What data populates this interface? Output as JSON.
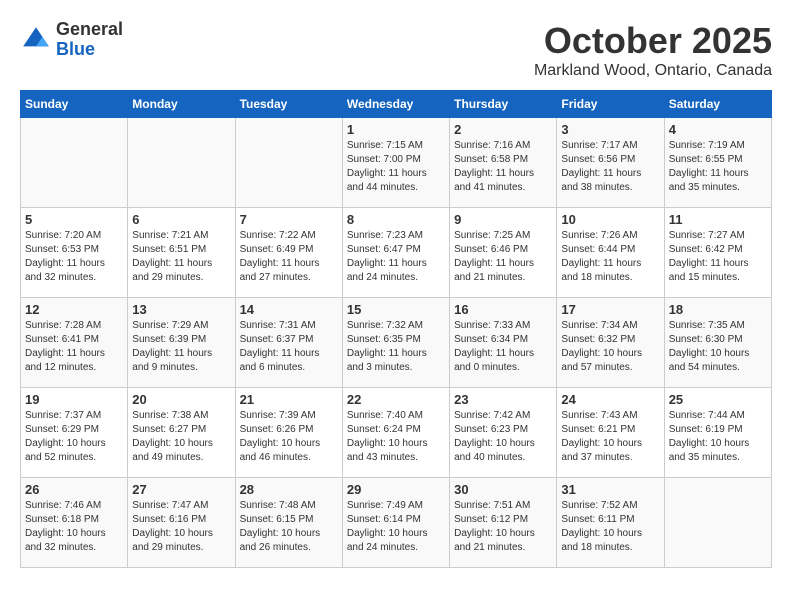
{
  "header": {
    "logo_line1": "General",
    "logo_line2": "Blue",
    "month": "October 2025",
    "location": "Markland Wood, Ontario, Canada"
  },
  "weekdays": [
    "Sunday",
    "Monday",
    "Tuesday",
    "Wednesday",
    "Thursday",
    "Friday",
    "Saturday"
  ],
  "weeks": [
    [
      {
        "day": "",
        "info": ""
      },
      {
        "day": "",
        "info": ""
      },
      {
        "day": "",
        "info": ""
      },
      {
        "day": "1",
        "info": "Sunrise: 7:15 AM\nSunset: 7:00 PM\nDaylight: 11 hours and 44 minutes."
      },
      {
        "day": "2",
        "info": "Sunrise: 7:16 AM\nSunset: 6:58 PM\nDaylight: 11 hours and 41 minutes."
      },
      {
        "day": "3",
        "info": "Sunrise: 7:17 AM\nSunset: 6:56 PM\nDaylight: 11 hours and 38 minutes."
      },
      {
        "day": "4",
        "info": "Sunrise: 7:19 AM\nSunset: 6:55 PM\nDaylight: 11 hours and 35 minutes."
      }
    ],
    [
      {
        "day": "5",
        "info": "Sunrise: 7:20 AM\nSunset: 6:53 PM\nDaylight: 11 hours and 32 minutes."
      },
      {
        "day": "6",
        "info": "Sunrise: 7:21 AM\nSunset: 6:51 PM\nDaylight: 11 hours and 29 minutes."
      },
      {
        "day": "7",
        "info": "Sunrise: 7:22 AM\nSunset: 6:49 PM\nDaylight: 11 hours and 27 minutes."
      },
      {
        "day": "8",
        "info": "Sunrise: 7:23 AM\nSunset: 6:47 PM\nDaylight: 11 hours and 24 minutes."
      },
      {
        "day": "9",
        "info": "Sunrise: 7:25 AM\nSunset: 6:46 PM\nDaylight: 11 hours and 21 minutes."
      },
      {
        "day": "10",
        "info": "Sunrise: 7:26 AM\nSunset: 6:44 PM\nDaylight: 11 hours and 18 minutes."
      },
      {
        "day": "11",
        "info": "Sunrise: 7:27 AM\nSunset: 6:42 PM\nDaylight: 11 hours and 15 minutes."
      }
    ],
    [
      {
        "day": "12",
        "info": "Sunrise: 7:28 AM\nSunset: 6:41 PM\nDaylight: 11 hours and 12 minutes."
      },
      {
        "day": "13",
        "info": "Sunrise: 7:29 AM\nSunset: 6:39 PM\nDaylight: 11 hours and 9 minutes."
      },
      {
        "day": "14",
        "info": "Sunrise: 7:31 AM\nSunset: 6:37 PM\nDaylight: 11 hours and 6 minutes."
      },
      {
        "day": "15",
        "info": "Sunrise: 7:32 AM\nSunset: 6:35 PM\nDaylight: 11 hours and 3 minutes."
      },
      {
        "day": "16",
        "info": "Sunrise: 7:33 AM\nSunset: 6:34 PM\nDaylight: 11 hours and 0 minutes."
      },
      {
        "day": "17",
        "info": "Sunrise: 7:34 AM\nSunset: 6:32 PM\nDaylight: 10 hours and 57 minutes."
      },
      {
        "day": "18",
        "info": "Sunrise: 7:35 AM\nSunset: 6:30 PM\nDaylight: 10 hours and 54 minutes."
      }
    ],
    [
      {
        "day": "19",
        "info": "Sunrise: 7:37 AM\nSunset: 6:29 PM\nDaylight: 10 hours and 52 minutes."
      },
      {
        "day": "20",
        "info": "Sunrise: 7:38 AM\nSunset: 6:27 PM\nDaylight: 10 hours and 49 minutes."
      },
      {
        "day": "21",
        "info": "Sunrise: 7:39 AM\nSunset: 6:26 PM\nDaylight: 10 hours and 46 minutes."
      },
      {
        "day": "22",
        "info": "Sunrise: 7:40 AM\nSunset: 6:24 PM\nDaylight: 10 hours and 43 minutes."
      },
      {
        "day": "23",
        "info": "Sunrise: 7:42 AM\nSunset: 6:23 PM\nDaylight: 10 hours and 40 minutes."
      },
      {
        "day": "24",
        "info": "Sunrise: 7:43 AM\nSunset: 6:21 PM\nDaylight: 10 hours and 37 minutes."
      },
      {
        "day": "25",
        "info": "Sunrise: 7:44 AM\nSunset: 6:19 PM\nDaylight: 10 hours and 35 minutes."
      }
    ],
    [
      {
        "day": "26",
        "info": "Sunrise: 7:46 AM\nSunset: 6:18 PM\nDaylight: 10 hours and 32 minutes."
      },
      {
        "day": "27",
        "info": "Sunrise: 7:47 AM\nSunset: 6:16 PM\nDaylight: 10 hours and 29 minutes."
      },
      {
        "day": "28",
        "info": "Sunrise: 7:48 AM\nSunset: 6:15 PM\nDaylight: 10 hours and 26 minutes."
      },
      {
        "day": "29",
        "info": "Sunrise: 7:49 AM\nSunset: 6:14 PM\nDaylight: 10 hours and 24 minutes."
      },
      {
        "day": "30",
        "info": "Sunrise: 7:51 AM\nSunset: 6:12 PM\nDaylight: 10 hours and 21 minutes."
      },
      {
        "day": "31",
        "info": "Sunrise: 7:52 AM\nSunset: 6:11 PM\nDaylight: 10 hours and 18 minutes."
      },
      {
        "day": "",
        "info": ""
      }
    ]
  ]
}
